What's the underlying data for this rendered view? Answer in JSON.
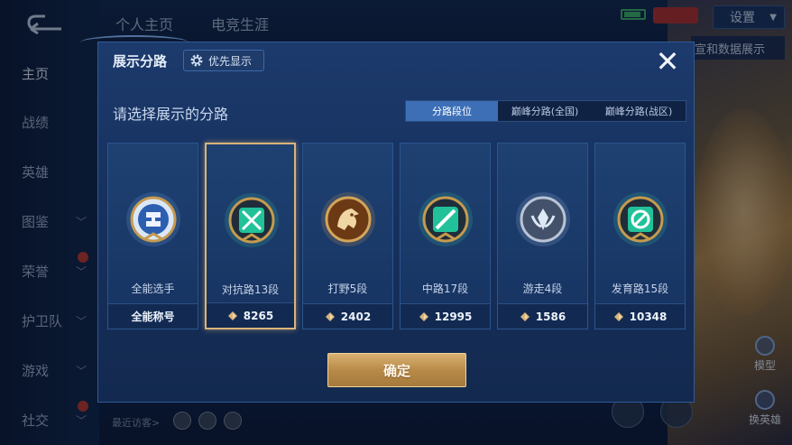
{
  "colors": {
    "accent_blue": "#3d6fb6",
    "gold": "#d9b37a",
    "panel": "#173260"
  },
  "sidebar": {
    "items": [
      {
        "label": "主页",
        "active": true,
        "chevron": false
      },
      {
        "label": "战绩",
        "active": false,
        "chevron": false
      },
      {
        "label": "英雄",
        "active": false,
        "chevron": false
      },
      {
        "label": "图鉴",
        "active": false,
        "chevron": true
      },
      {
        "label": "荣誉",
        "active": false,
        "chevron": true,
        "dot": true
      },
      {
        "label": "护卫队",
        "active": false,
        "chevron": true
      },
      {
        "label": "游戏",
        "active": false,
        "chevron": true
      },
      {
        "label": "社交",
        "active": false,
        "chevron": true,
        "dot": true
      }
    ]
  },
  "header": {
    "tabs": [
      "个人主页",
      "电竞生涯"
    ],
    "settings_label": "设置",
    "tooltip_text": "宣和数据展示"
  },
  "right_buttons": {
    "model_label": "模型",
    "switch_hero_label": "换英雄"
  },
  "bottom": {
    "visitors_label": "最近访客>"
  },
  "modal": {
    "title": "展示分路",
    "priority_label": "优先显示",
    "close_glyph": "✕",
    "prompt": "请选择展示的分路",
    "filter_tabs": [
      "分路段位",
      "巅峰分路(全国)",
      "巅峰分路(战区)"
    ],
    "active_filter": 0,
    "cards": [
      {
        "name": "全能选手",
        "value": "全能称号",
        "emblem": "all-round-emblem-icon",
        "selected": false,
        "show_points_icon": false
      },
      {
        "name": "对抗路13段",
        "value": "8265",
        "emblem": "clash-lane-emblem-icon",
        "selected": true,
        "show_points_icon": true
      },
      {
        "name": "打野5段",
        "value": "2402",
        "emblem": "jungle-emblem-icon",
        "selected": false,
        "show_points_icon": true
      },
      {
        "name": "中路17段",
        "value": "12995",
        "emblem": "mid-lane-emblem-icon",
        "selected": false,
        "show_points_icon": true
      },
      {
        "name": "游走4段",
        "value": "1586",
        "emblem": "roam-emblem-icon",
        "selected": false,
        "show_points_icon": true
      },
      {
        "name": "发育路15段",
        "value": "10348",
        "emblem": "farm-lane-emblem-icon",
        "selected": false,
        "show_points_icon": true
      }
    ],
    "confirm_label": "确定"
  }
}
